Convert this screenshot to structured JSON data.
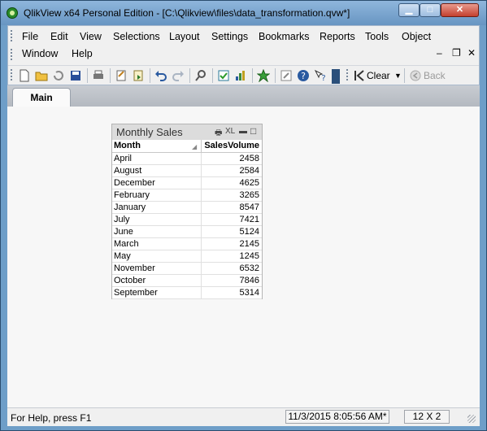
{
  "window": {
    "title": "QlikView x64 Personal Edition - [C:\\Qlikview\\files\\data_transformation.qvw*]",
    "controls": {
      "minimize": "▁",
      "maximize": "□",
      "close": "✕"
    }
  },
  "menu": {
    "items": [
      "File",
      "Edit",
      "View",
      "Selections",
      "Layout",
      "Settings",
      "Bookmarks",
      "Reports",
      "Tools",
      "Object",
      "Window",
      "Help"
    ],
    "mdi_controls": {
      "minimize": "–",
      "restore": "❐",
      "close": "✕"
    }
  },
  "toolbar": {
    "clear_label": "Clear",
    "back_label": "Back",
    "icons": [
      "new-icon",
      "open-icon",
      "reload-icon",
      "save-icon",
      "print-icon",
      "edit-script-icon",
      "reload-data-icon",
      "undo-icon",
      "redo-icon",
      "search-icon",
      "list-icon",
      "chart-icon",
      "bookmark-star-icon",
      "edit-icon",
      "help-icon",
      "what-is-this-icon"
    ]
  },
  "tabs": [
    {
      "label": "Main"
    }
  ],
  "table_box": {
    "title": "Monthly Sales",
    "caption_icons": {
      "print": "🖶",
      "xl": "XL",
      "minimize": "▬",
      "maximize": "□"
    },
    "columns": [
      "Month",
      "SalesVolume"
    ],
    "rows": [
      [
        "April",
        "2458"
      ],
      [
        "August",
        "2584"
      ],
      [
        "December",
        "4625"
      ],
      [
        "February",
        "3265"
      ],
      [
        "January",
        "8547"
      ],
      [
        "July",
        "7421"
      ],
      [
        "June",
        "5124"
      ],
      [
        "March",
        "2145"
      ],
      [
        "May",
        "1245"
      ],
      [
        "November",
        "6532"
      ],
      [
        "October",
        "7846"
      ],
      [
        "September",
        "5314"
      ]
    ]
  },
  "status": {
    "help": "For Help, press F1",
    "timestamp": "11/3/2015 8:05:56 AM*",
    "dimensions": "12 X 2"
  },
  "colors": {
    "title_bar": "#6795c2",
    "close_button": "#c4402e",
    "caption_bg": "#dcdcdc"
  }
}
